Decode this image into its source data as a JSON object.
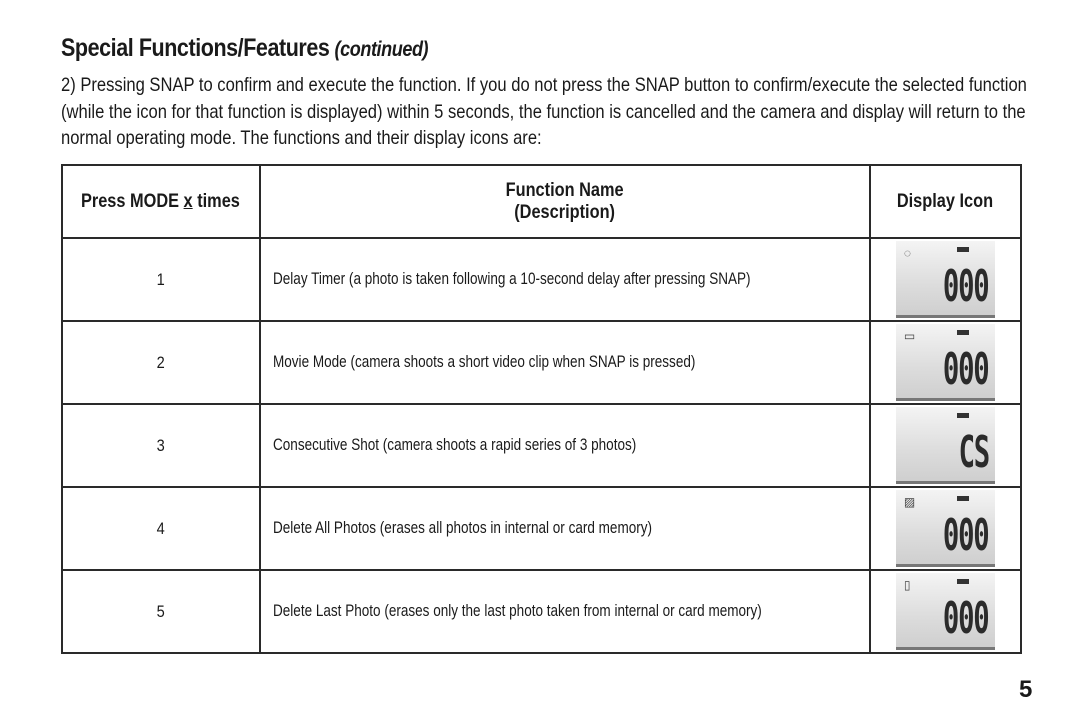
{
  "heading": {
    "title": "Special Functions/Features",
    "continued": "(continued)"
  },
  "intro": {
    "lines": [
      "2) Pressing SNAP to confirm and execute the function. If you do not press the SNAP button to confirm/execute the selected function",
      "(while the icon for that function is displayed) within 5 seconds, the function is cancelled and the camera and display will return to the",
      "normal operating mode. The functions and their display icons are:"
    ]
  },
  "table": {
    "headers": {
      "press_prefix": "Press MODE ",
      "press_x": "x",
      "press_suffix": " times",
      "function_name": "Function Name",
      "description": "(Description)",
      "display_icon": "Display Icon"
    },
    "rows": [
      {
        "presses": "1",
        "description": "Delay Timer (a photo is taken following a 10-second delay after pressing SNAP)",
        "icon": {
          "name": "delay-timer-lcd-icon",
          "symbol": "◌",
          "readout": "000"
        }
      },
      {
        "presses": "2",
        "description": "Movie Mode (camera shoots a short video clip when SNAP is pressed)",
        "icon": {
          "name": "movie-mode-lcd-icon",
          "symbol": "▭",
          "readout": "000"
        }
      },
      {
        "presses": "3",
        "description": "Consecutive Shot (camera shoots a rapid series of 3 photos)",
        "icon": {
          "name": "consecutive-shot-lcd-icon",
          "symbol": "",
          "readout": "CS"
        }
      },
      {
        "presses": "4",
        "description": "Delete All Photos (erases all photos in internal or card memory)",
        "icon": {
          "name": "delete-all-lcd-icon",
          "symbol": "▨",
          "readout": "000"
        }
      },
      {
        "presses": "5",
        "description": "Delete Last Photo (erases only the last photo taken from internal or card memory)",
        "icon": {
          "name": "delete-last-lcd-icon",
          "symbol": "▯",
          "readout": "000"
        }
      }
    ]
  },
  "page_number": "5"
}
